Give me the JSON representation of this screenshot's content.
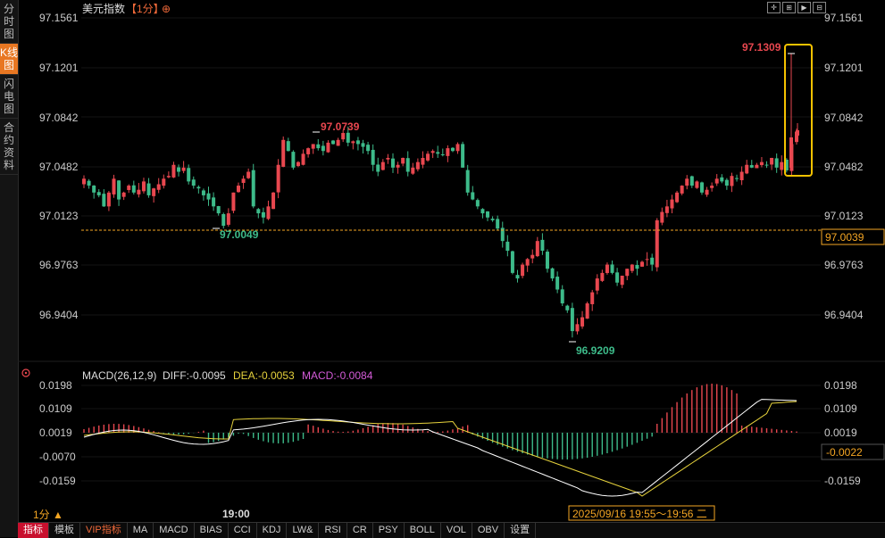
{
  "sidebar": {
    "tabs": [
      {
        "label": "分时图",
        "active": false
      },
      {
        "label": "K线图",
        "active": true
      },
      {
        "label": "闪电图",
        "active": false
      },
      {
        "label": "合约资料",
        "active": false
      }
    ]
  },
  "header": {
    "instrument": "美元指数",
    "period": "【1分】",
    "add_icon": "⊕",
    "toolbar_icons": [
      "crosshair-icon",
      "zoom-in-icon",
      "play-icon",
      "zoom-out-icon"
    ]
  },
  "price_axis": {
    "ticks": [
      "97.1561",
      "97.1201",
      "97.0842",
      "97.0482",
      "97.0123",
      "96.9763",
      "96.9404"
    ],
    "current_price": "97.0039"
  },
  "annotations": {
    "high_1": "97.0739",
    "low_1": "97.0049",
    "low_2": "96.9209",
    "high_2": "97.1309"
  },
  "macd": {
    "title": "MACD(26,12,9)",
    "diff_label": "DIFF:-0.0095",
    "dea_label": "DEA:-0.0053",
    "macd_label": "MACD:-0.0084",
    "ticks": [
      "0.0198",
      "0.0109",
      "0.0019",
      "-0.0070",
      "-0.0159"
    ],
    "current_value": "-0.0022"
  },
  "time_axis": {
    "period_label": "1分 ▲",
    "time_label": "19:00",
    "cursor_label": "2025/09/16 19:55～19:56 二"
  },
  "bottom_tabs": [
    "指标",
    "模板",
    "VIP指标",
    "MA",
    "MACD",
    "BIAS",
    "CCI",
    "KDJ",
    "LW&",
    "RSI",
    "CR",
    "PSY",
    "BOLL",
    "VOL",
    "OBV",
    "设置"
  ],
  "colors": {
    "up": "#e8474f",
    "down": "#3dbb8a",
    "diff": "#ffffff",
    "dea": "#e6d23c",
    "macd_label": "#d45bd8",
    "highlight": "#f5c200",
    "current_line": "#f5a623"
  },
  "chart_data": {
    "type": "candlestick",
    "interval": "1m",
    "y_range": [
      96.9204,
      97.1561
    ],
    "close_approx": [
      97.04,
      97.035,
      97.03,
      97.028,
      97.02,
      97.03,
      97.04,
      97.025,
      97.03,
      97.035,
      97.03,
      97.032,
      97.038,
      97.028,
      97.033,
      97.036,
      97.04,
      97.042,
      97.05,
      97.045,
      97.048,
      97.038,
      97.035,
      97.033,
      97.028,
      97.025,
      97.02,
      97.015,
      97.006,
      97.015,
      97.03,
      97.035,
      97.04,
      97.045,
      97.02,
      97.015,
      97.012,
      97.02,
      97.03,
      97.05,
      97.068,
      97.06,
      97.048,
      97.052,
      97.058,
      97.062,
      97.065,
      97.062,
      97.06,
      97.066,
      97.065,
      97.068,
      97.073,
      97.066,
      97.067,
      97.065,
      97.063,
      97.06,
      97.05,
      97.045,
      97.052,
      97.055,
      97.048,
      97.05,
      97.055,
      97.045,
      97.048,
      97.052,
      97.055,
      97.058,
      97.06,
      97.058,
      97.057,
      97.062,
      97.06,
      97.065,
      97.048,
      97.03,
      97.025,
      97.02,
      97.015,
      97.012,
      97.01,
      97.004,
      96.995,
      96.988,
      96.972,
      96.968,
      96.978,
      96.982,
      96.985,
      96.995,
      96.988,
      96.975,
      96.968,
      96.96,
      96.95,
      96.945,
      96.93,
      96.935,
      96.94,
      96.95,
      96.958,
      96.968,
      96.972,
      96.978,
      96.972,
      96.965,
      96.97,
      96.975,
      96.978,
      96.975,
      96.98,
      96.982,
      96.978,
      97.01,
      97.016,
      97.02,
      97.025,
      97.03,
      97.035,
      97.04,
      97.035,
      97.038,
      97.03,
      97.032,
      97.035,
      97.04,
      97.038,
      97.035,
      97.042,
      97.04,
      97.045,
      97.05,
      97.048,
      97.05,
      97.052,
      97.05,
      97.055,
      97.048,
      97.052,
      97.046,
      97.065,
      97.074
    ]
  }
}
